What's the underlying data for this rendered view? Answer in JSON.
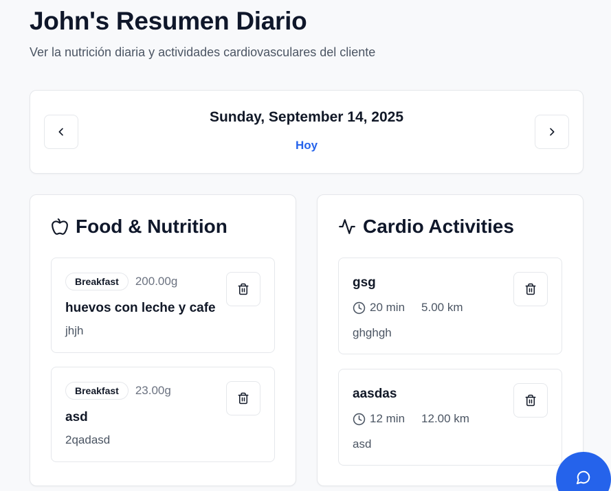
{
  "header": {
    "title": "John's Resumen Diario",
    "subtitle": "Ver la nutrición diaria y actividades cardiovasculares del cliente"
  },
  "date_nav": {
    "date": "Sunday, September 14, 2025",
    "today_label": "Hoy"
  },
  "food": {
    "title": "Food & Nutrition",
    "entries": [
      {
        "meal": "Breakfast",
        "weight": "200.00g",
        "name": "huevos con leche y cafe",
        "notes": "jhjh"
      },
      {
        "meal": "Breakfast",
        "weight": "23.00g",
        "name": "asd",
        "notes": "2qadasd"
      }
    ]
  },
  "cardio": {
    "title": "Cardio Activities",
    "entries": [
      {
        "name": "gsg",
        "duration": "20 min",
        "distance": "5.00 km",
        "notes": "ghghgh"
      },
      {
        "name": "aasdas",
        "duration": "12 min",
        "distance": "12.00 km",
        "notes": "asd"
      }
    ]
  },
  "icons": {
    "prev": "chevron-left-icon",
    "next": "chevron-right-icon",
    "food": "apple-icon",
    "cardio": "activity-icon",
    "delete": "trash-icon",
    "duration": "clock-icon",
    "chat": "chat-bubble-icon"
  },
  "colors": {
    "accent": "#2563eb",
    "background": "#f8f9fb",
    "card": "#ffffff",
    "border": "#e5e7eb"
  }
}
